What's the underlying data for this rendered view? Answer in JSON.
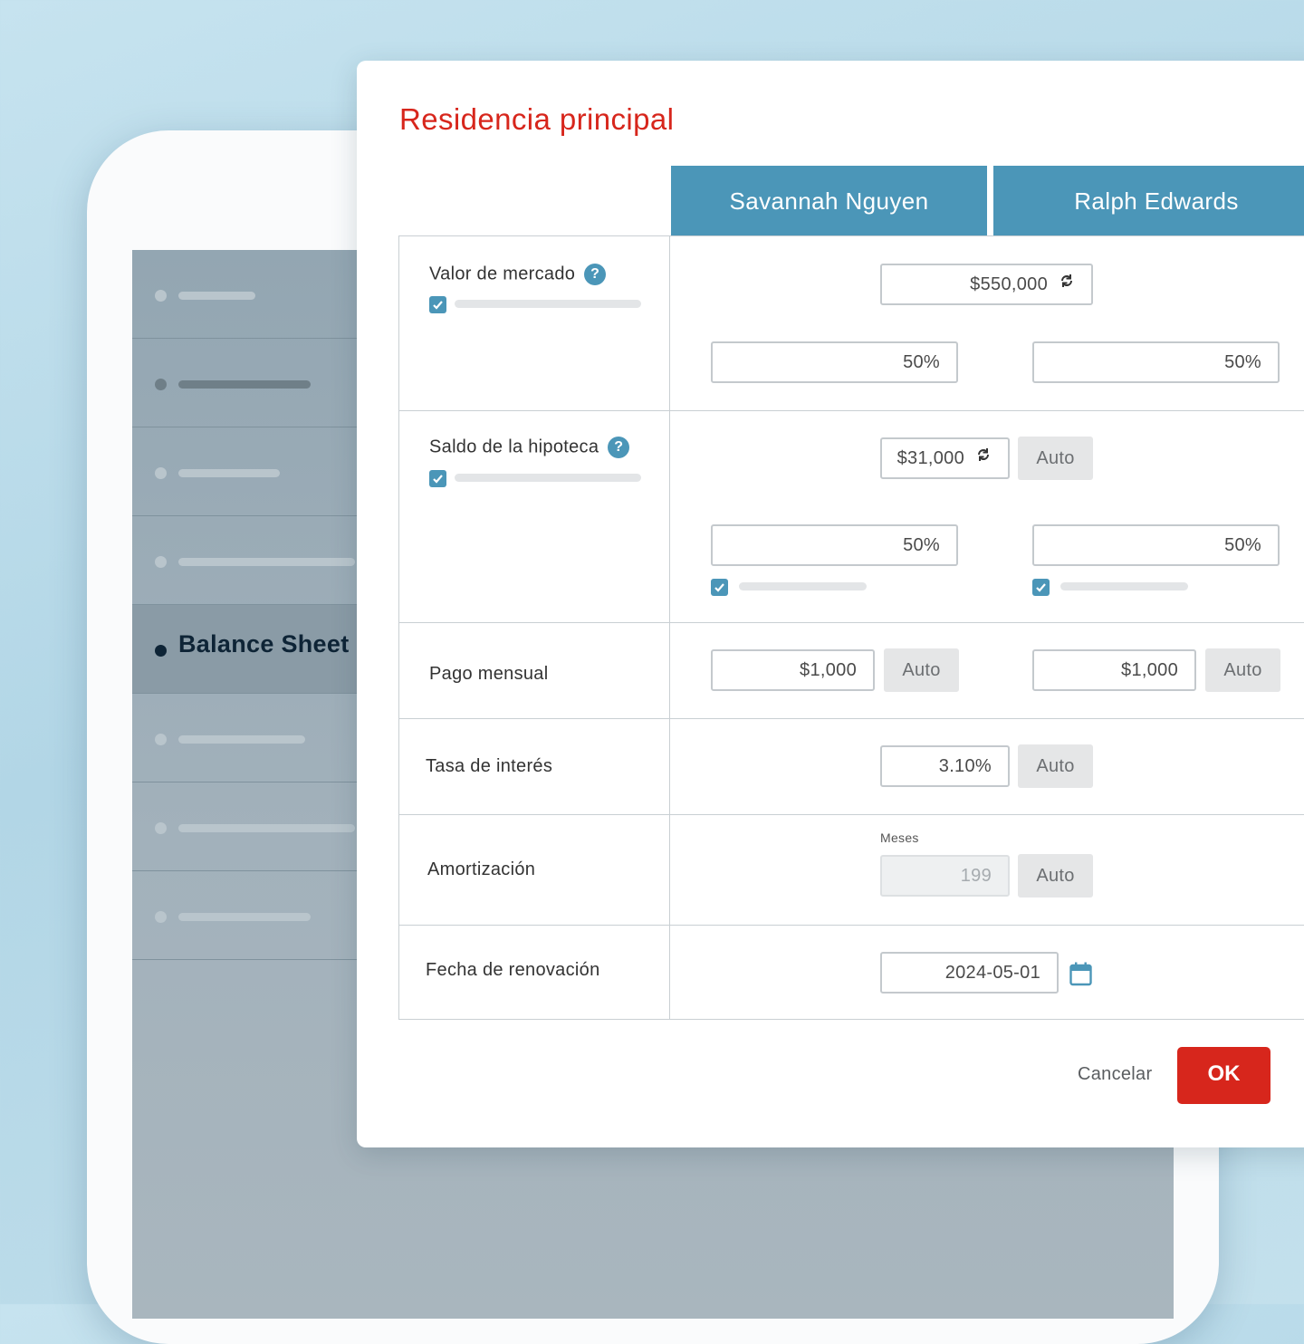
{
  "sidebar": {
    "active_label": "Balance Sheet"
  },
  "dialog": {
    "title": "Residencia principal",
    "columns": [
      "Savannah Nguyen",
      "Ralph Edwards"
    ],
    "market_value": {
      "label": "Valor de mercado",
      "help": "?",
      "checked": true,
      "value": "$550,000",
      "split": [
        "50%",
        "50%"
      ]
    },
    "mortgage_balance": {
      "label": "Saldo de la hipoteca",
      "help": "?",
      "checked": true,
      "value": "$31,000",
      "auto": "Auto",
      "split": [
        "50%",
        "50%"
      ],
      "split_checked": [
        true,
        true
      ]
    },
    "monthly_payment": {
      "label": "Pago mensual",
      "values": [
        "$1,000",
        "$1,000"
      ],
      "auto": "Auto"
    },
    "interest_rate": {
      "label": "Tasa de interés",
      "value": "3.10%",
      "auto": "Auto"
    },
    "amortization": {
      "label": "Amortización",
      "sub_label": "Meses",
      "value": "199",
      "auto": "Auto"
    },
    "renewal_date": {
      "label": "Fecha de renovación",
      "value": "2024-05-01"
    },
    "cancel_label": "Cancelar",
    "ok_label": "OK"
  },
  "colors": {
    "accent": "#4b96b8",
    "brand_red": "#d7261c"
  }
}
